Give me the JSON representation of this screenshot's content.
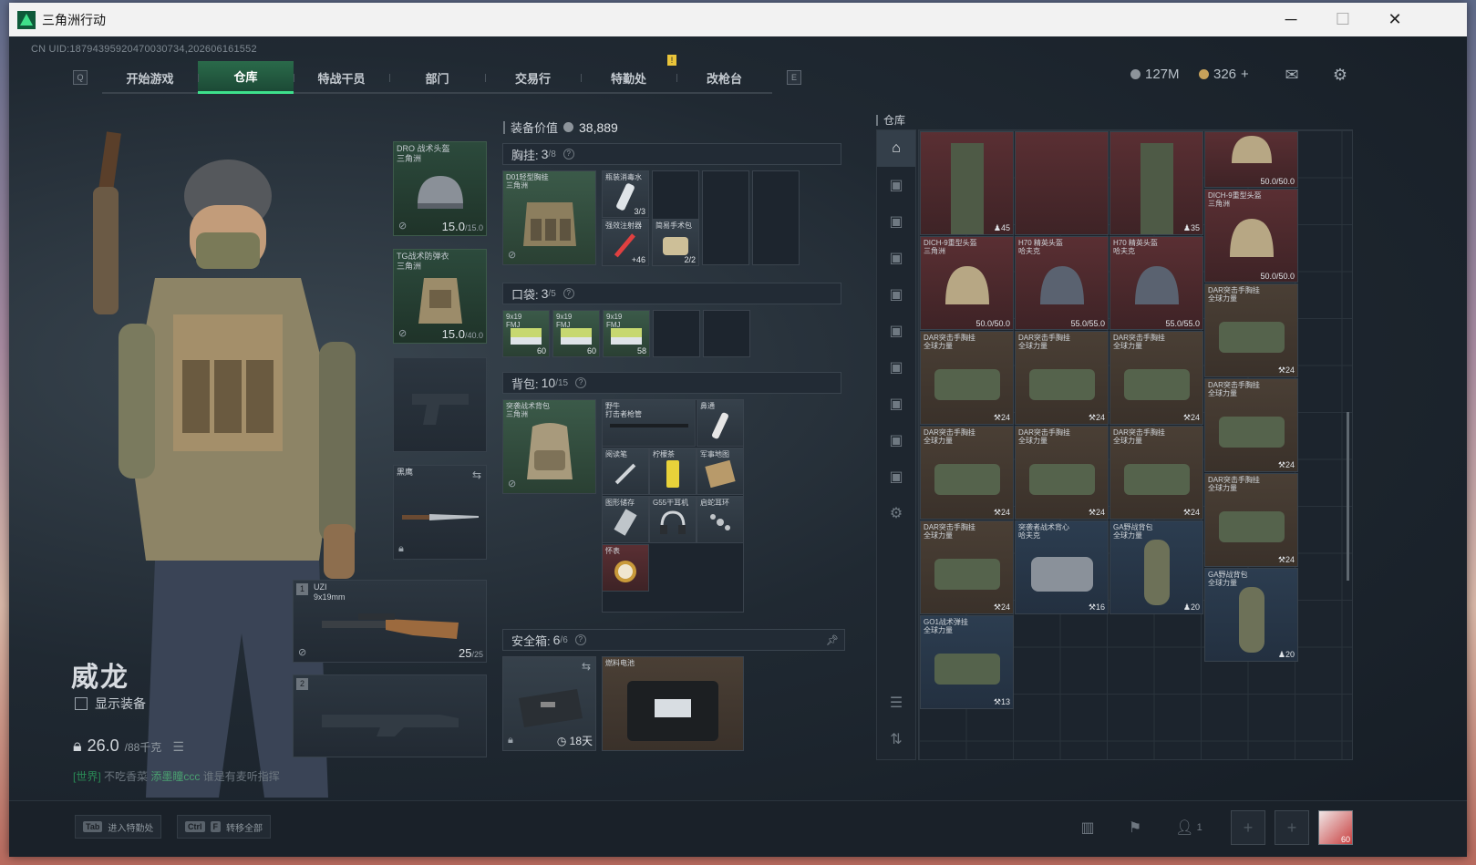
{
  "window": {
    "title": "三角洲行动",
    "controls": [
      "─",
      "☐",
      "✕"
    ]
  },
  "uid": "CN UID:18794395920470030734,202606161552",
  "nav": {
    "left_key": "Q",
    "right_key": "E",
    "tabs": [
      "开始游戏",
      "仓库",
      "特战干员",
      "部门",
      "交易行",
      "特勤处",
      "改枪台"
    ],
    "active": "仓库",
    "notification": "!"
  },
  "currency": {
    "coins": "127M",
    "gold": "326",
    "plus": "+"
  },
  "character": {
    "name": "威龙",
    "show_equipment": "显示装备",
    "weight": "26.0",
    "weight_max": "/88千克"
  },
  "chat": {
    "channel": "[世界]",
    "name": "不吃香菜",
    "sender": "添墨瞳ccc",
    "message": "谁是有麦听指挥"
  },
  "equipment": {
    "helmet": {
      "name": "DRO 战术头盔",
      "brand": "三角洲",
      "dur": "15.0",
      "max": "/15.0"
    },
    "armor": {
      "name": "TG战术防弹衣",
      "brand": "三角洲",
      "dur": "15.0",
      "max": "/40.0"
    },
    "melee": {
      "name": "黑鹰"
    },
    "primary": {
      "num": "1",
      "name": "UZI",
      "caliber": "9x19mm",
      "ammo": "25",
      "ammo_max": "/25"
    },
    "secondary": {
      "num": "2"
    }
  },
  "loadout": {
    "value_label": "装备价值",
    "value": "38,889",
    "chest": {
      "label": "胸挂:",
      "count": "3",
      "total": "/8",
      "q": "?"
    },
    "pocket": {
      "label": "口袋:",
      "count": "3",
      "total": "/5",
      "q": "?"
    },
    "backpack": {
      "label": "背包:",
      "count": "10",
      "total": "/15",
      "q": "?"
    },
    "safebox": {
      "label": "安全箱:",
      "count": "6",
      "total": "/6",
      "q": "?",
      "days": "18天"
    },
    "chest_items": [
      {
        "label": "D01轻型胸挂\n三角洲"
      },
      {
        "label": "瓶装消毒水",
        "count": "3/3"
      },
      {
        "label": "强效注射器",
        "count": "+46"
      },
      {
        "label": "简易手术包",
        "count": "2/2"
      }
    ],
    "pocket_items": [
      {
        "label": "9x19\nFMJ",
        "count": "60"
      },
      {
        "label": "9x19\nFMJ",
        "count": "60"
      },
      {
        "label": "9x19\nFMJ",
        "count": "58"
      }
    ],
    "backpack_items": [
      {
        "label": "突袭战术背包\n三角洲"
      },
      {
        "label": "野牛\n打击者枪管"
      },
      {
        "label": "鼻通"
      },
      {
        "label": "阅读笔"
      },
      {
        "label": "柠檬茶"
      },
      {
        "label": "军事地图"
      },
      {
        "label": "图形储存"
      },
      {
        "label": "G55干耳机"
      },
      {
        "label": "启蛇耳环"
      },
      {
        "label": "怀表"
      }
    ],
    "safebox_item": {
      "label": "燃料电池"
    }
  },
  "storage": {
    "title": "仓库",
    "items": [
      {
        "label": "",
        "count": "45"
      },
      {
        "label": "",
        "count": "35"
      },
      {
        "label": "",
        "count": "50.0/50.0"
      },
      {
        "label": "DICH-9重型头盔\n三角洲",
        "count": "50.0/50.0"
      },
      {
        "label": "DICH-9重型头盔\n三角洲",
        "count": "50.0/50.0"
      },
      {
        "label": "H70 精英头盔\n哈夫克",
        "count": "55.0/55.0"
      },
      {
        "label": "H70 精英头盔\n哈夫克",
        "count": "55.0/55.0"
      },
      {
        "label": "DAR突击手胸挂\n全球力量",
        "count": "24"
      },
      {
        "label": "DAR突击手胸挂\n全球力量",
        "count": "24"
      },
      {
        "label": "DAR突击手胸挂\n全球力量",
        "count": "24"
      },
      {
        "label": "DAR突击手胸挂\n全球力量",
        "count": "24"
      },
      {
        "label": "DAR突击手胸挂\n全球力量",
        "count": "24"
      },
      {
        "label": "DAR突击手胸挂\n全球力量",
        "count": "24"
      },
      {
        "label": "DAR突击手胸挂\n全球力量",
        "count": "24"
      },
      {
        "label": "DAR突击手胸挂\n全球力量",
        "count": "24"
      },
      {
        "label": "DAR突击手胸挂\n全球力量",
        "count": "24"
      },
      {
        "label": "DAR突击手胸挂\n全球力量",
        "count": "24"
      },
      {
        "label": "突袭者战术背心\n哈夫克",
        "count": "16"
      },
      {
        "label": "GA野战背包\n全球力量",
        "count": "20"
      },
      {
        "label": "GA野战背包\n全球力量",
        "count": "20"
      },
      {
        "label": "GO1战术弹挂\n全球力量",
        "count": "13"
      }
    ]
  },
  "bottom": {
    "hint1_key": "Tab",
    "hint1": "进入特勤处",
    "hint2_key1": "Ctrl",
    "hint2_key2": "F",
    "hint2": "转移全部",
    "team_count": "1",
    "avatar_level": "60"
  },
  "colors": {
    "accent": "#3ee08c",
    "active_tab": "#2a6a4a",
    "panel": "#1b2430"
  }
}
